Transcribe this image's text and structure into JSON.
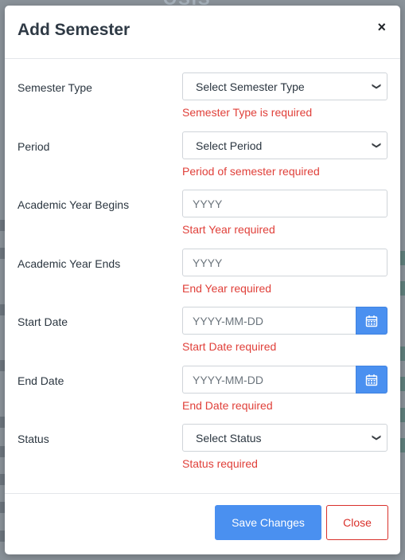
{
  "backdrop": {
    "logo_text": "OSIS"
  },
  "modal": {
    "title": "Add Semester",
    "close_glyph": "×"
  },
  "fields": [
    {
      "label": "Semester Type",
      "kind": "select",
      "value": "Select Semester Type",
      "error": "Semester Type is required"
    },
    {
      "label": "Period",
      "kind": "select",
      "value": "Select Period",
      "error": "Period of semester required"
    },
    {
      "label": "Academic Year Begins",
      "kind": "input",
      "placeholder": "YYYY",
      "error": "Start Year required"
    },
    {
      "label": "Academic Year Ends",
      "kind": "input",
      "placeholder": "YYYY",
      "error": "End Year required"
    },
    {
      "label": "Start Date",
      "kind": "date",
      "placeholder": "YYYY-MM-DD",
      "error": "Start Date required",
      "icon": "calendar-icon"
    },
    {
      "label": "End Date",
      "kind": "date",
      "placeholder": "YYYY-MM-DD",
      "error": "End Date required",
      "icon": "calendar-icon"
    },
    {
      "label": "Status",
      "kind": "select",
      "value": "Select Status",
      "error": "Status required"
    }
  ],
  "footer": {
    "save_label": "Save Changes",
    "close_label": "Close"
  },
  "colors": {
    "primary": "#4a90f0",
    "error": "#e0403a",
    "danger": "#d9312b"
  }
}
